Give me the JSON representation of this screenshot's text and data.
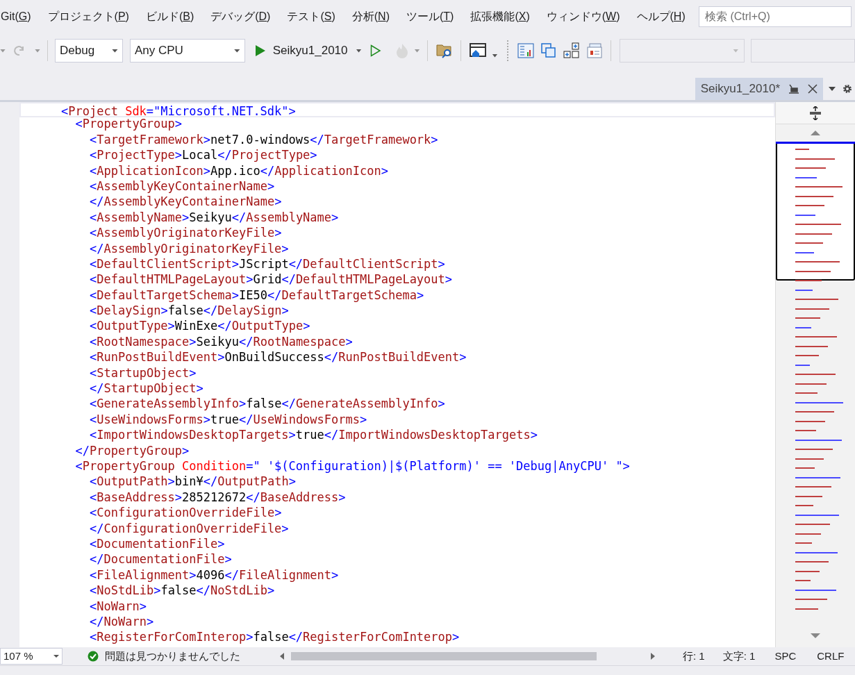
{
  "menu": [
    "Git(G)",
    "プロジェクト(P)",
    "ビルド(B)",
    "デバッグ(D)",
    "テスト(S)",
    "分析(N)",
    "ツール(T)",
    "拡張機能(X)",
    "ウィンドウ(W)",
    "ヘルプ(H)"
  ],
  "search": {
    "placeholder": "検索 (Ctrl+Q)"
  },
  "toolbar": {
    "configuration": "Debug",
    "platform": "Any CPU",
    "start_target": "Seikyu1_2010"
  },
  "tabs": [
    {
      "label": "Seikyu1_2010*",
      "selected": true
    }
  ],
  "code_lines": [
    {
      "text": "<Project Sdk=\"Microsoft.NET.Sdk\">",
      "children": [
        {
          "text": "<PropertyGroup>",
          "children": [
            {
              "text": "<TargetFramework>net7.0-windows</TargetFramework>"
            },
            {
              "text": "<ProjectType>Local</ProjectType>"
            },
            {
              "text": "<ApplicationIcon>App.ico</ApplicationIcon>"
            },
            {
              "text": "<AssemblyKeyContainerName>"
            },
            {
              "text": "</AssemblyKeyContainerName>"
            },
            {
              "text": "<AssemblyName>Seikyu</AssemblyName>"
            },
            {
              "text": "<AssemblyOriginatorKeyFile>"
            },
            {
              "text": "</AssemblyOriginatorKeyFile>"
            },
            {
              "text": "<DefaultClientScript>JScript</DefaultClientScript>"
            },
            {
              "text": "<DefaultHTMLPageLayout>Grid</DefaultHTMLPageLayout>"
            },
            {
              "text": "<DefaultTargetSchema>IE50</DefaultTargetSchema>"
            },
            {
              "text": "<DelaySign>false</DelaySign>"
            },
            {
              "text": "<OutputType>WinExe</OutputType>"
            },
            {
              "text": "<RootNamespace>Seikyu</RootNamespace>"
            },
            {
              "text": "<RunPostBuildEvent>OnBuildSuccess</RunPostBuildEvent>"
            },
            {
              "text": "<StartupObject>"
            },
            {
              "text": "</StartupObject>"
            },
            {
              "text": "<GenerateAssemblyInfo>false</GenerateAssemblyInfo>"
            },
            {
              "text": "<UseWindowsForms>true</UseWindowsForms>"
            },
            {
              "text": "<ImportWindowsDesktopTargets>true</ImportWindowsDesktopTargets>"
            }
          ]
        },
        {
          "text": "</PropertyGroup>"
        },
        {
          "text": "<PropertyGroup Condition=\" '$(Configuration)|$(Platform)' == 'Debug|AnyCPU' \">",
          "children": [
            {
              "text": "<OutputPath>bin¥</OutputPath>"
            },
            {
              "text": "<BaseAddress>285212672</BaseAddress>"
            },
            {
              "text": "<ConfigurationOverrideFile>"
            },
            {
              "text": "</ConfigurationOverrideFile>"
            },
            {
              "text": "<DocumentationFile>"
            },
            {
              "text": "</DocumentationFile>"
            },
            {
              "text": "<FileAlignment>4096</FileAlignment>"
            },
            {
              "text": "<NoStdLib>false</NoStdLib>"
            },
            {
              "text": "<NoWarn>"
            },
            {
              "text": "</NoWarn>"
            },
            {
              "text": "<RegisterForComInterop>false</RegisterForComInterop>"
            }
          ]
        }
      ]
    }
  ],
  "status_bar": {
    "zoom": "107 %",
    "issues": "問題は見つかりませんでした",
    "line": "行: 1",
    "column": "文字: 1",
    "whitespace": "SPC",
    "line_ending": "CRLF"
  }
}
